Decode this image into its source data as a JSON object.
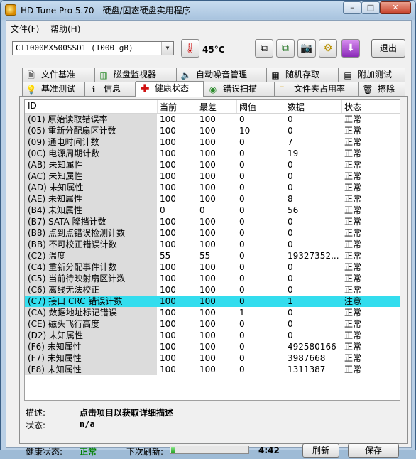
{
  "window": {
    "title": "HD Tune Pro 5.70 - 硬盘/固态硬盘实用程序",
    "min": "–",
    "max": "□",
    "close": "✕"
  },
  "menu": {
    "file": "文件(F)",
    "help": "帮助(H)"
  },
  "toolbar": {
    "drive": "CT1000MX500SSD1 (1000 gB)",
    "temperature": "45°C",
    "exit": "退出"
  },
  "tabs_row1": [
    {
      "label": "文件基准",
      "icon": "file-icon"
    },
    {
      "label": "磁盘监视器",
      "icon": "chart-icon"
    },
    {
      "label": "自动噪音管理",
      "icon": "speaker-icon"
    },
    {
      "label": "随机存取",
      "icon": "random-icon"
    },
    {
      "label": "附加测试",
      "icon": "extra-icon"
    }
  ],
  "tabs_row2": [
    {
      "label": "基准测试",
      "icon": "bulb-icon"
    },
    {
      "label": "信息",
      "icon": "info-icon"
    },
    {
      "label": "健康状态",
      "icon": "health-icon"
    },
    {
      "label": "错误扫描",
      "icon": "scan-icon"
    },
    {
      "label": "文件夹占用率",
      "icon": "folder-icon"
    },
    {
      "label": "擦除",
      "icon": "trash-icon"
    }
  ],
  "columns": [
    "ID",
    "当前",
    "最差",
    "阈值",
    "数据",
    "状态"
  ],
  "rows": [
    {
      "id": "(01) 原始读取错误率",
      "cur": "100",
      "worst": "100",
      "thr": "0",
      "data": "0",
      "status": "正常"
    },
    {
      "id": "(05) 重新分配扇区计数",
      "cur": "100",
      "worst": "100",
      "thr": "10",
      "data": "0",
      "status": "正常"
    },
    {
      "id": "(09) 通电时间计数",
      "cur": "100",
      "worst": "100",
      "thr": "0",
      "data": "7",
      "status": "正常"
    },
    {
      "id": "(0C) 电源周期计数",
      "cur": "100",
      "worst": "100",
      "thr": "0",
      "data": "19",
      "status": "正常"
    },
    {
      "id": "(AB) 未知属性",
      "cur": "100",
      "worst": "100",
      "thr": "0",
      "data": "0",
      "status": "正常"
    },
    {
      "id": "(AC) 未知属性",
      "cur": "100",
      "worst": "100",
      "thr": "0",
      "data": "0",
      "status": "正常"
    },
    {
      "id": "(AD) 未知属性",
      "cur": "100",
      "worst": "100",
      "thr": "0",
      "data": "0",
      "status": "正常"
    },
    {
      "id": "(AE) 未知属性",
      "cur": "100",
      "worst": "100",
      "thr": "0",
      "data": "8",
      "status": "正常"
    },
    {
      "id": "(B4) 未知属性",
      "cur": "0",
      "worst": "0",
      "thr": "0",
      "data": "56",
      "status": "正常"
    },
    {
      "id": "(B7) SATA 降挡计数",
      "cur": "100",
      "worst": "100",
      "thr": "0",
      "data": "0",
      "status": "正常"
    },
    {
      "id": "(B8) 点到点错误检测计数",
      "cur": "100",
      "worst": "100",
      "thr": "0",
      "data": "0",
      "status": "正常"
    },
    {
      "id": "(BB) 不可校正错误计数",
      "cur": "100",
      "worst": "100",
      "thr": "0",
      "data": "0",
      "status": "正常"
    },
    {
      "id": "(C2) 温度",
      "cur": "55",
      "worst": "55",
      "thr": "0",
      "data": "19327352...",
      "status": "正常"
    },
    {
      "id": "(C4) 重新分配事件计数",
      "cur": "100",
      "worst": "100",
      "thr": "0",
      "data": "0",
      "status": "正常"
    },
    {
      "id": "(C5) 当前待映射扇区计数",
      "cur": "100",
      "worst": "100",
      "thr": "0",
      "data": "0",
      "status": "正常"
    },
    {
      "id": "(C6) 离线无法校正",
      "cur": "100",
      "worst": "100",
      "thr": "0",
      "data": "0",
      "status": "正常"
    },
    {
      "id": "(C7) 接口 CRC 错误计数",
      "cur": "100",
      "worst": "100",
      "thr": "0",
      "data": "1",
      "status": "注意",
      "selected": true
    },
    {
      "id": "(CA) 数据地址标记错误",
      "cur": "100",
      "worst": "100",
      "thr": "1",
      "data": "0",
      "status": "正常"
    },
    {
      "id": "(CE) 磁头飞行高度",
      "cur": "100",
      "worst": "100",
      "thr": "0",
      "data": "0",
      "status": "正常"
    },
    {
      "id": "(D2) 未知属性",
      "cur": "100",
      "worst": "100",
      "thr": "0",
      "data": "0",
      "status": "正常"
    },
    {
      "id": "(F6) 未知属性",
      "cur": "100",
      "worst": "100",
      "thr": "0",
      "data": "492580166",
      "status": "正常"
    },
    {
      "id": "(F7) 未知属性",
      "cur": "100",
      "worst": "100",
      "thr": "0",
      "data": "3987668",
      "status": "正常"
    },
    {
      "id": "(F8) 未知属性",
      "cur": "100",
      "worst": "100",
      "thr": "0",
      "data": "1311387",
      "status": "正常"
    }
  ],
  "description": {
    "desc_label": "描述:",
    "desc_value": "点击项目以获取详细描述",
    "status_label": "状态:",
    "status_value": "n/a"
  },
  "footer": {
    "health_label": "健康状态:",
    "health_value": "正常",
    "health_color": "#008000",
    "refresh_label": "下次刷新:",
    "refresh_time": "4:42",
    "refresh_progress": 0.05,
    "refresh_button": "刷新",
    "save_button": "保存"
  },
  "colors": {
    "selected_row": "#33ddee"
  }
}
